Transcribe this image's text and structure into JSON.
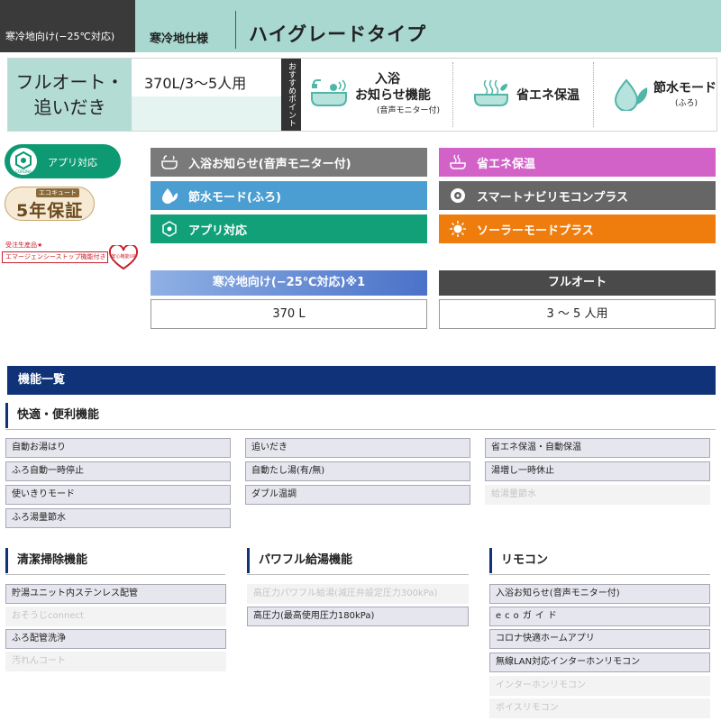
{
  "header": {
    "tag": "寒冷地向け(−25℃対応)",
    "subtitle": "寒冷地仕様",
    "title": "ハイグレードタイプ"
  },
  "product": {
    "name_line1": "フルオート・",
    "name_line2": "追いだき",
    "capacity": "370L/3〜5人用",
    "recommend_label": "おすすめポイント",
    "features": [
      {
        "line1": "入浴",
        "line2": "お知らせ機能",
        "small": "(音声モニター付)",
        "icon": "bath-icon"
      },
      {
        "line1": "省エネ保温",
        "icon": "eco-bath-icon"
      },
      {
        "line1": "節水モード",
        "small": "(ふろ)",
        "icon": "water-drop-leaf-icon"
      }
    ]
  },
  "badges": {
    "app": "アプリ対応",
    "app_logo": "CORONA",
    "warranty_top": "エコキュート",
    "warranty_main": "5年保証",
    "award_top": "受注生産品★",
    "award_bar": "エマージェンシーストップ機能付き",
    "award_heart": "安心機能UP"
  },
  "feature_buttons": [
    {
      "label": "入浴お知らせ(音声モニター付)",
      "color": "#7a7a7a",
      "icon": "bath-notify-icon"
    },
    {
      "label": "省エネ保温",
      "color": "#d262c8",
      "icon": "eco-warm-icon"
    },
    {
      "label": "節水モード(ふろ)",
      "color": "#4a9ed2",
      "icon": "water-saving-icon"
    },
    {
      "label": "スマートナビリモコンプラス",
      "color": "#666666",
      "icon": "remote-icon"
    },
    {
      "label": "アプリ対応",
      "color": "#11a078",
      "icon": "app-icon"
    },
    {
      "label": "ソーラーモードプラス",
      "color": "#ef7d0e",
      "icon": "sun-icon"
    }
  ],
  "specs": {
    "left_head": "寒冷地向け(−25℃対応)※1",
    "left_value": "370 L",
    "right_head": "フルオート",
    "right_value": "3 〜 5 人用"
  },
  "function_list": {
    "title": "機能一覧",
    "sections": [
      {
        "title": "快適・便利機能",
        "columns": [
          [
            {
              "label": "自動お湯はり",
              "enabled": true
            },
            {
              "label": "ふろ自動一時停止",
              "enabled": true
            },
            {
              "label": "使いきりモード",
              "enabled": true
            },
            {
              "label": "ふろ湯量節水",
              "enabled": true
            }
          ],
          [
            {
              "label": "追いだき",
              "enabled": true
            },
            {
              "label": "自動たし湯(有/無)",
              "enabled": true
            },
            {
              "label": "ダブル温調",
              "enabled": true
            }
          ],
          [
            {
              "label": "省エネ保温・自動保温",
              "enabled": true
            },
            {
              "label": "湯増し一時休止",
              "enabled": true
            },
            {
              "label": "給湯量節水",
              "enabled": false
            }
          ]
        ]
      },
      {
        "title": "清潔掃除機能",
        "items": [
          {
            "label": "貯湯ユニット内ステンレス配管",
            "enabled": true
          },
          {
            "label": "おそうじconnect",
            "enabled": false
          },
          {
            "label": "ふろ配管洗浄",
            "enabled": true
          },
          {
            "label": "汚れんコート",
            "enabled": false
          }
        ]
      },
      {
        "title": "パワフル給湯機能",
        "items": [
          {
            "label": "高圧力パワフル給湯(減圧弁設定圧力300kPa)",
            "enabled": false
          },
          {
            "label": "高圧力(最高使用圧力180kPa)",
            "enabled": true
          }
        ]
      },
      {
        "title": "リモコン",
        "items": [
          {
            "label": "入浴お知らせ(音声モニター付)",
            "enabled": true
          },
          {
            "label": "ecoガイド",
            "enabled": true
          },
          {
            "label": "コロナ快適ホームアプリ",
            "enabled": true
          },
          {
            "label": "無線LAN対応インターホンリモコン",
            "enabled": true
          },
          {
            "label": "インターホンリモコン",
            "enabled": false
          },
          {
            "label": "ボイスリモコン",
            "enabled": false
          }
        ]
      }
    ]
  }
}
